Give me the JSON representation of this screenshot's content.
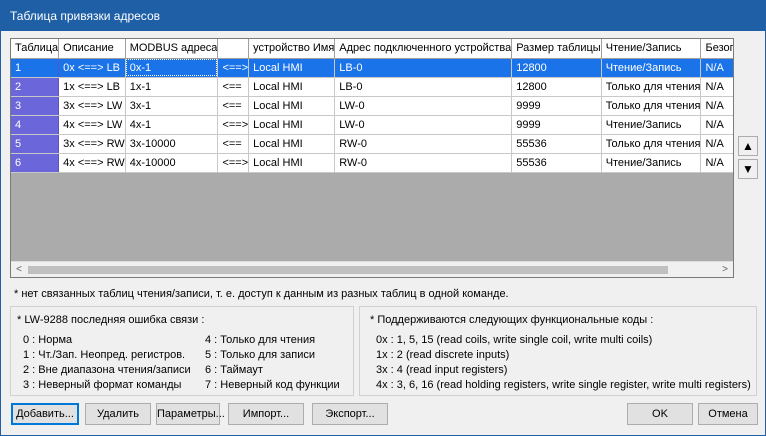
{
  "window": {
    "title": "Таблица привязки адресов"
  },
  "table": {
    "headers": [
      "Таблица",
      "Описание",
      "MODBUS адреса",
      "",
      "устройство Имя",
      "Адрес подключенного устройства",
      "Размер таблицы",
      "Чтение/Запись",
      "Безопа"
    ],
    "rows": [
      [
        "1",
        "0x <==> LB",
        "0x-1",
        "<==>",
        "Local HMI",
        "LB-0",
        "12800",
        "Чтение/Запись",
        "N/A"
      ],
      [
        "2",
        "1x <==> LB",
        "1x-1",
        "<==",
        "Local HMI",
        "LB-0",
        "12800",
        "Только для чтения",
        "N/A"
      ],
      [
        "3",
        "3x <==> LW",
        "3x-1",
        "<==",
        "Local HMI",
        "LW-0",
        "9999",
        "Только для чтения",
        "N/A"
      ],
      [
        "4",
        "4x <==> LW",
        "4x-1",
        "<==>",
        "Local HMI",
        "LW-0",
        "9999",
        "Чтение/Запись",
        "N/A"
      ],
      [
        "5",
        "3x <==> RW",
        "3x-10000",
        "<==",
        "Local HMI",
        "RW-0",
        "55536",
        "Только для чтения",
        "N/A"
      ],
      [
        "6",
        "4x <==> RW",
        "4x-10000",
        "<==>",
        "Local HMI",
        "RW-0",
        "55536",
        "Чтение/Запись",
        "N/A"
      ]
    ],
    "selected_row": 0
  },
  "scroll": {
    "left_arrow": "<",
    "right_arrow": ">"
  },
  "side_buttons": {
    "up": "▲",
    "down": "▼"
  },
  "note": "* нет связанных таблиц чтения/записи, т. е. доступ к данным из разных таблиц в одной команде.",
  "errors_panel": {
    "title": "* LW-9288 последняя ошибка связи :",
    "left": [
      "0 : Норма",
      "1 : Чт./Зап. Неопред. регистров.",
      "2 : Вне диапазона чтения/записи",
      "3 : Неверный формат команды"
    ],
    "right": [
      "4 : Только для чтения",
      "5 : Только для записи",
      "6 : Таймаут",
      "7 : Неверный код функции"
    ]
  },
  "codes_panel": {
    "title": "* Поддерживаются следующих функциональные коды :",
    "lines": [
      "0x : 1, 5, 15 (read coils, write single coil, write multi coils)",
      "1x : 2 (read discrete inputs)",
      "3x : 4 (read input registers)",
      "4x : 3, 6, 16 (read holding registers, write single register, write multi registers)"
    ]
  },
  "buttons": {
    "add": "Добавить...",
    "delete": "Удалить",
    "params": "Параметры...",
    "import": "Импорт...",
    "export": "Экспорт...",
    "ok": "OK",
    "cancel": "Отмена"
  }
}
